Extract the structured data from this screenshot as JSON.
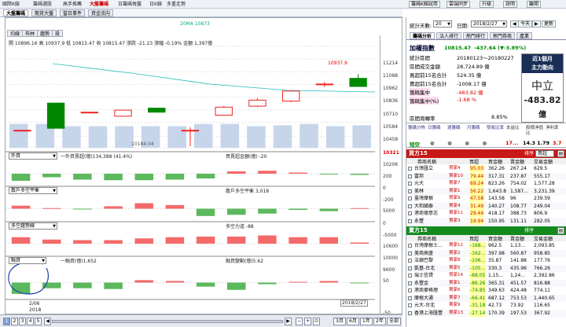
{
  "topbar": {
    "items": [
      "國際K線",
      "籌碼選股",
      "高手推薦",
      "大盤籌碼",
      "日籌碼每盤",
      "日K線",
      "多重走勢"
    ],
    "active_index": 3,
    "right_buttons": [
      "籌碼K線試用",
      "雲端同步",
      "升級",
      "說明",
      "離開"
    ]
  },
  "subtabs": [
    "大盤籌碼",
    "期貨大盤",
    "當日事件",
    "資金流向"
  ],
  "chart": {
    "ma_label": "20MA 10873",
    "toggles": [
      "均線",
      "布林",
      "趨勢",
      "設"
    ],
    "ohlc": "開 10896.16  高 10937.9  低 10815.47  收 10815.47  漲跌 -21.23  漲幅 -0.19%  金額 1,397億",
    "price_axis": [
      "11214",
      "11088",
      "10962",
      "10836",
      "10710",
      "10584",
      "10458",
      "10321",
      "10206"
    ],
    "price_tag": "10321",
    "hi_label": "10937.9",
    "lo_label": "10184.04",
    "candles": [
      {
        "o": 10380,
        "c": 10380,
        "h": 10380,
        "l": 10380
      },
      {
        "o": 10650,
        "c": 10400,
        "h": 10650,
        "l": 10400
      },
      {
        "o": 10560,
        "c": 10560,
        "h": 10560,
        "l": 10560
      },
      {
        "o": 10520,
        "c": 10580,
        "h": 10580,
        "l": 10515
      },
      {
        "o": 10600,
        "c": 10560,
        "h": 10600,
        "l": 10555
      },
      {
        "o": 10380,
        "c": 10380,
        "h": 10410,
        "l": 10220
      },
      {
        "o": 10530,
        "c": 10610,
        "h": 10620,
        "l": 10525
      },
      {
        "o": 10620,
        "c": 10680,
        "h": 10700,
        "l": 10610
      },
      {
        "o": 10670,
        "c": 10770,
        "h": 10780,
        "l": 10660
      },
      {
        "o": 10840,
        "c": 10840,
        "h": 10860,
        "l": 10810
      },
      {
        "o": 10896.16,
        "c": 10815.47,
        "h": 10937.9,
        "l": 10815.47
      }
    ],
    "volume": [
      0.55,
      0.55,
      0.5,
      0.5,
      0.5,
      0.5,
      0.5,
      0.55,
      0.55,
      0.5,
      0.52,
      0.55,
      0.5,
      0.52
    ],
    "panels": [
      {
        "select": "外資",
        "label": "一外資賣超(億)134,388 (41.4%)",
        "label2": "買賣超金額(億) -20",
        "axis": [
          "200",
          "0",
          "-200"
        ],
        "vals": [
          -0.6,
          -0.3,
          -0.5,
          -0.55,
          -0.55,
          -0.5,
          -0.4,
          0.2,
          0.25,
          0.1,
          -0.05,
          -0.1
        ]
      },
      {
        "select": "散戶多空平衡",
        "label": "",
        "label2": "散戶多空平衡 3,018",
        "axis": [
          "5000",
          "0",
          "-5000"
        ],
        "vals": [
          0.25,
          0.05,
          -0.05,
          0.2,
          0.45,
          0.3,
          -0.6,
          -0.5,
          -0.4,
          -0.1,
          -0.2,
          0.05
        ]
      },
      {
        "select": "多空趨勢線",
        "label": "",
        "label2": "多空力道 -88",
        "axis": [
          "10600",
          "10000",
          "9600"
        ],
        "vals": [
          0.55,
          0.35,
          0.3,
          0.3,
          0.45,
          0.55,
          0.6,
          0.6,
          0.7,
          0.55,
          0.55,
          0.1
        ]
      },
      {
        "select": "融資",
        "label": "一融資(億)1,652",
        "label2": "融資變動(億)5.62",
        "axis": [
          "50",
          "-50"
        ],
        "vals": [
          -0.7,
          -0.35,
          -0.35,
          -0.4,
          0.15,
          0.1,
          -0.25,
          -0.45,
          -0.1,
          0.05,
          0.1,
          -0.05
        ]
      }
    ],
    "date_left": "2/06",
    "year_left": "2018",
    "date_right": "2018/2/27"
  },
  "bottom": {
    "pages": [
      "1",
      "2",
      "3",
      "4",
      "5"
    ],
    "ranges": [
      "3月",
      "6月",
      "1年",
      "2年",
      "全部"
    ]
  },
  "right": {
    "stat_days_label": "統計天數:",
    "stat_days": "20",
    "date_label": "日期:",
    "date": "2018/2/27",
    "today": "今天",
    "refresh": "更新",
    "tabs": [
      "籌碼分析",
      "法人排行",
      "熱門排行",
      "熱門券商",
      "產業"
    ],
    "index_name": "加權指數",
    "index_value": "10815.47",
    "index_change": "-437.64",
    "index_pct": "(▼-3.89%)",
    "stats": [
      {
        "k": "統計區間",
        "v": "20180123～20180227"
      },
      {
        "k": "區間成交金額",
        "v": "28,724.89 億"
      },
      {
        "k": "買超前15名合計",
        "v": "524.35 億"
      },
      {
        "k": "賣超前15名合計",
        "v": "-1008.17 億"
      },
      {
        "k": "籌碼集中",
        "v": "-483.82 億"
      },
      {
        "k": "籌碼集中(%)",
        "v": "-1.68 %"
      }
    ],
    "turnover_label": "區間周轉率",
    "turnover": "8.85%",
    "card_title1": "近1個月",
    "card_title2": "主力動向",
    "card_mid": "中立",
    "card_val": "-483.82",
    "card_unit": "億",
    "mini_headers": [
      "籌碼分佈",
      "日籌碼",
      "週籌碼",
      "月籌碼",
      "發收比率",
      "本益比",
      "股價淨值比",
      "淨利率"
    ],
    "mini_row0": "短空",
    "mini_vals": [
      "17...",
      "14.3",
      "1.79",
      "3.7"
    ],
    "buy_title": "買方15",
    "sell_title": "賣方15",
    "cols": [
      "券商名稱",
      "買超",
      "買金額",
      "賣金額",
      "交易金額"
    ],
    "buy_rows": [
      [
        "台灣匯立",
        "買家4",
        "95.03",
        "362.26",
        "267.24",
        "629.5"
      ],
      [
        "富邦",
        "賣家10",
        "79.44",
        "317.31",
        "237.87",
        "555.17"
      ],
      [
        "元大",
        "賣家7",
        "69.24",
        "823.26",
        "754.02",
        "1,577.28"
      ],
      [
        "美林",
        "賣家1",
        "56.22",
        "1,643.8",
        "1,587...",
        "3,231.39"
      ],
      [
        "臺灣摩根",
        "買家9",
        "47.58",
        "143.58",
        "96",
        "239.59"
      ],
      [
        "大和國泰",
        "賣家4",
        "31.49",
        "140.27",
        "108.77",
        "249.04"
      ],
      [
        "港商德意志",
        "賣家11",
        "29.44",
        "418.17",
        "388.73",
        "806.9"
      ],
      [
        "永豐",
        "賣家3",
        "19.94",
        "150.95",
        "131.11",
        "282.05"
      ]
    ],
    "sell_rows": [
      [
        "台灣摩根士...",
        "賣家12",
        "-168...",
        "962.5",
        "1,13...",
        "2,093.85"
      ],
      [
        "美商高盛",
        "賣家2",
        "-162...",
        "397.98",
        "560.87",
        "958.85"
      ],
      [
        "法銀巴黎",
        "賣家8",
        "-106...",
        "35.87",
        "141.88",
        "177.76"
      ],
      [
        "凱基-台北",
        "賣家5",
        "-105...",
        "330.3",
        "435.96",
        "766.26"
      ],
      [
        "瑞士信貸",
        "買家14",
        "-88.05",
        "1,15...",
        "1,24...",
        "2,392.86"
      ],
      [
        "永豐金",
        "賣家1",
        "-86.26",
        "365.31",
        "451.57",
        "816.88"
      ],
      [
        "港商麥格理",
        "賣家6",
        "-74.85",
        "349.63",
        "424.48",
        "774.11"
      ],
      [
        "摩根大通",
        "賣家7",
        "-66.41",
        "687.12",
        "753.53",
        "1,440.65"
      ],
      [
        "元大-台北",
        "賣家9",
        "-31.18",
        "42.73",
        "73.92",
        "116.65"
      ],
      [
        "香港上海匯豐",
        "賣家13",
        "-27.14",
        "170.39",
        "197.53",
        "367.92"
      ]
    ],
    "sort_label": "排序",
    "sort_value": "買超"
  }
}
